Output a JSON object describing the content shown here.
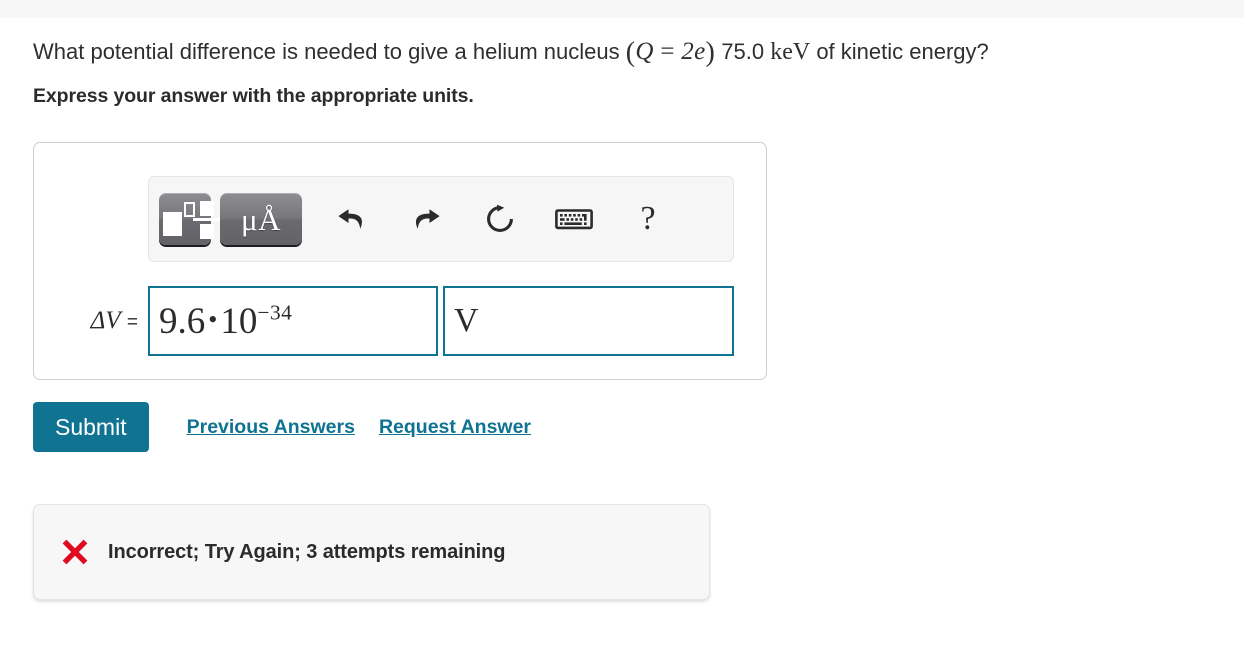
{
  "question": {
    "lead": "What potential difference is needed to give a helium nucleus",
    "math_open_paren": "(",
    "math_q": "Q",
    "math_eq": "=",
    "math_2": "2",
    "math_e": "e",
    "math_close_paren": ")",
    "value": "75.0",
    "unit": "keV",
    "trail": "of kinetic energy?"
  },
  "instruction": "Express your answer with the appropriate units.",
  "toolbar": {
    "template_button": "math-template",
    "units_button": "μÅ",
    "undo": "undo",
    "redo": "redo",
    "reset": "reset",
    "keyboard": "keyboard",
    "help": "?"
  },
  "entry": {
    "label_delta": "Δ",
    "label_var": "V",
    "label_eq": "=",
    "answer_mantissa": "9.6",
    "answer_dot": "•",
    "answer_base": "10",
    "answer_exponent": "−34",
    "units_value": "V"
  },
  "actions": {
    "submit_label": "Submit",
    "previous_answers_label": "Previous Answers",
    "request_answer_label": "Request Answer"
  },
  "feedback": {
    "icon": "red-x",
    "message": "Incorrect; Try Again; 3 attempts remaining"
  },
  "colors": {
    "accent_teal": "#0f7391",
    "error_red": "#e00b23",
    "text": "#2b2b2b",
    "panel_border": "#cfcfcf",
    "toolbar_bg": "#f6f6f6"
  }
}
